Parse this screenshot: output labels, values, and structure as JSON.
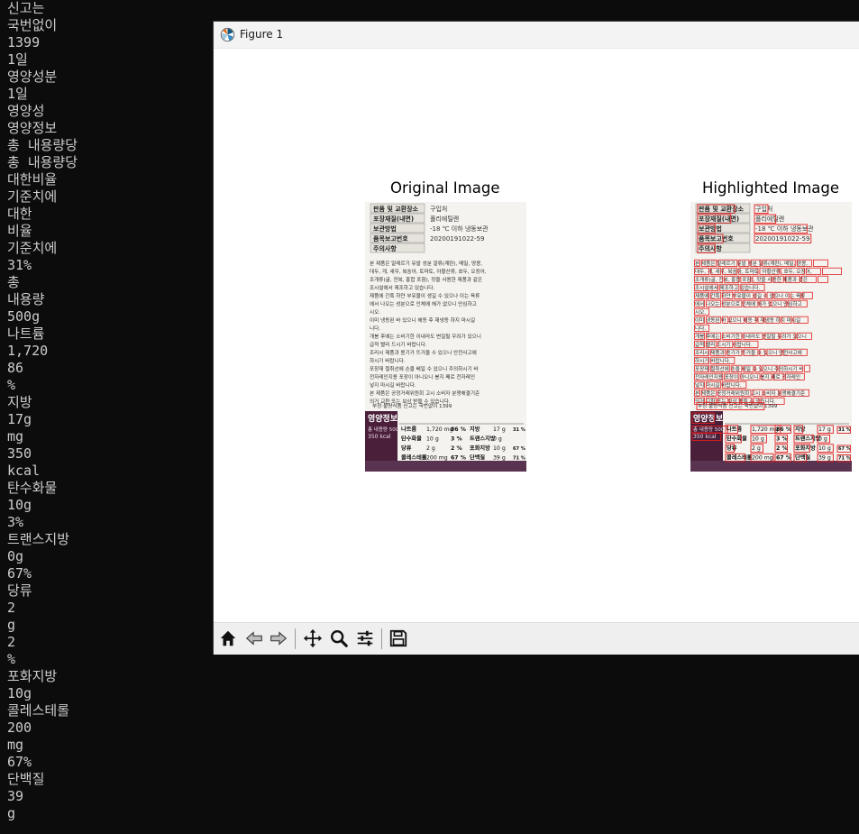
{
  "terminal": {
    "lines": [
      "신고는",
      "국번없이",
      "1399",
      "1일",
      "영양성분",
      "1일",
      "영양성",
      "영양정보",
      "총 내용량당",
      "총 내용량당",
      "대한비율",
      "기준치에",
      "대한",
      "비율",
      "기준치에",
      "31%",
      "총",
      "내용량",
      "500g",
      "나트륨",
      "1,720",
      "86",
      "%",
      "지방",
      "17g",
      "mg",
      "350",
      "kcal",
      "탄수화물",
      "10g",
      "3%",
      "트랜스지방",
      "0g",
      "67%",
      "당류",
      "2",
      "g",
      "2",
      "%",
      "포화지방",
      "10g",
      "콜레스테롤",
      "200",
      "mg",
      "67%",
      "단백질",
      "39",
      "g"
    ]
  },
  "window": {
    "title": "Figure 1",
    "title_icon": "matplotlib-icon",
    "axes": [
      {
        "title": "Original Image"
      },
      {
        "title": "Highlighted Image"
      }
    ],
    "toolbar": {
      "buttons": [
        "home-icon",
        "back-icon",
        "forward-icon",
        "pan-icon",
        "zoom-icon",
        "configure-icon",
        "save-icon"
      ]
    }
  },
  "product_label": {
    "rows": [
      {
        "k": "판품 및 교환장소",
        "v": "구입처"
      },
      {
        "k": "포장재질(내면)",
        "v": "폴리에틸렌"
      },
      {
        "k": "보관방법",
        "v": "-18 ℃ 이하 냉동보관"
      },
      {
        "k": "품목보고번호",
        "v": "20200191022-59"
      },
      {
        "k": "주의사항",
        "v": ""
      }
    ],
    "nutrition_title": "영양정보",
    "total": "총 내용량 500 g",
    "kcal": "350 kcal",
    "nutrients": [
      {
        "name": "나트륨",
        "amt": "1,720 mg",
        "pct": "86 %"
      },
      {
        "name": "탄수화물",
        "amt": "10 g",
        "pct": "3 %"
      },
      {
        "name": "당류",
        "amt": "2 g",
        "pct": "2 %"
      },
      {
        "name": "콜레스테롤",
        "amt": "200 mg",
        "pct": "67 %"
      }
    ],
    "nutrients_right": [
      {
        "name": "지방",
        "amt": "17 g",
        "pct": "31 %"
      },
      {
        "name": "트랜스지방",
        "amt": "0 g",
        "pct": ""
      },
      {
        "name": "포화지방",
        "amt": "10 g",
        "pct": "67 %"
      },
      {
        "name": "단백질",
        "amt": "39 g",
        "pct": "71 %"
      }
    ],
    "footer": "부정·불량식품 신고는 국번없이 1399"
  },
  "colors": {
    "highlight": "#e01e1e",
    "nutrition_header": "#4a1f3a",
    "label_bg": "#f4f3ef"
  }
}
